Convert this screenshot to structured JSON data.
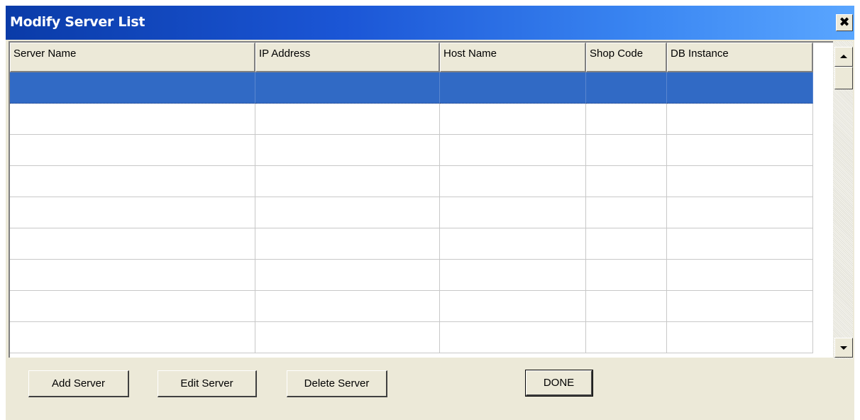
{
  "window": {
    "title": "Modify Server List",
    "close_glyph": "✖"
  },
  "table": {
    "columns": [
      "Server Name",
      "IP Address",
      "Host Name",
      "Shop Code",
      "DB Instance"
    ],
    "selected_row_index": 0,
    "rows": [
      [
        "",
        "",
        "",
        "",
        ""
      ],
      [
        "",
        "",
        "",
        "",
        ""
      ],
      [
        "",
        "",
        "",
        "",
        ""
      ],
      [
        "",
        "",
        "",
        "",
        ""
      ],
      [
        "",
        "",
        "",
        "",
        ""
      ],
      [
        "",
        "",
        "",
        "",
        ""
      ],
      [
        "",
        "",
        "",
        "",
        ""
      ],
      [
        "",
        "",
        "",
        "",
        ""
      ],
      [
        "",
        "",
        "",
        "",
        ""
      ]
    ]
  },
  "buttons": {
    "add": "Add Server",
    "edit": "Edit Server",
    "delete": "Delete Server",
    "done": "DONE"
  },
  "colors": {
    "selection": "#316ac5",
    "titlebar_start": "#0a3ba8",
    "titlebar_end": "#5aa6ff",
    "face": "#ece9d8"
  },
  "icons": {
    "close": "close-icon",
    "scroll_up": "arrow-up-icon",
    "scroll_down": "arrow-down-icon"
  }
}
